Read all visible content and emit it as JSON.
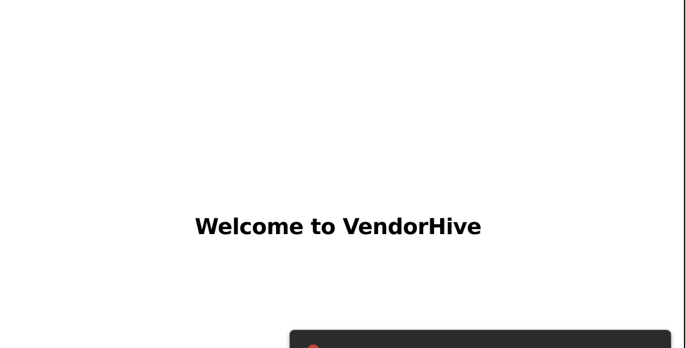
{
  "main": {
    "title": "Welcome to VendorHive"
  },
  "toast": {
    "status_icon": "error-icon",
    "status_color": "#c4453b"
  },
  "colors": {
    "background": "#ffffff",
    "toast_background": "#2b2b2b"
  }
}
